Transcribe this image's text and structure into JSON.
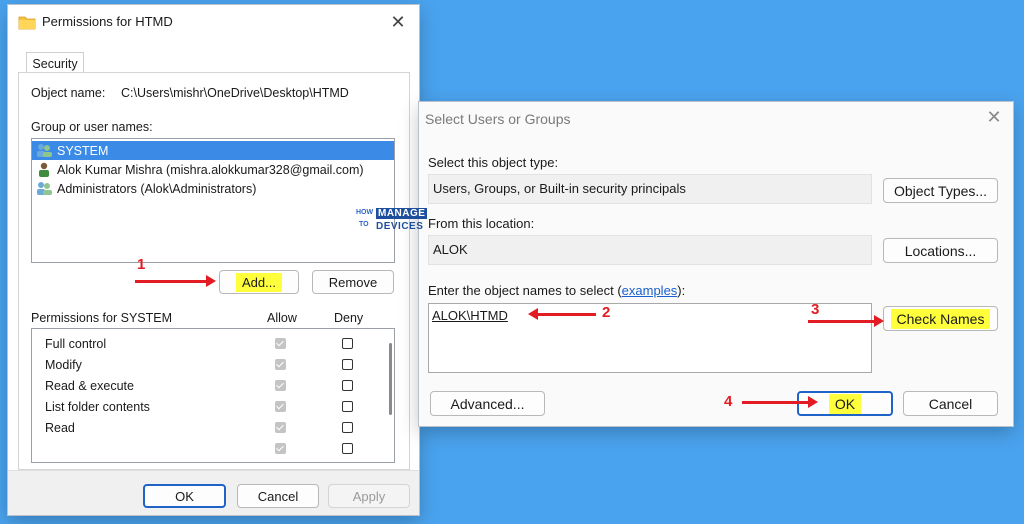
{
  "permissions_dialog": {
    "title": "Permissions for HTMD",
    "tab": "Security",
    "object_name_label": "Object name:",
    "object_name_value": "C:\\Users\\mishr\\OneDrive\\Desktop\\HTMD",
    "group_label": "Group or user names:",
    "users": [
      {
        "name": "SYSTEM",
        "selected": true
      },
      {
        "name": "Alok Kumar Mishra (mishra.alokkumar328@gmail.com)",
        "selected": false
      },
      {
        "name": "Administrators (Alok\\Administrators)",
        "selected": false
      }
    ],
    "add_label": "Add...",
    "remove_label": "Remove",
    "perm_header": "Permissions for SYSTEM",
    "allow_label": "Allow",
    "deny_label": "Deny",
    "permissions": [
      {
        "name": "Full control",
        "allow": true,
        "deny": false
      },
      {
        "name": "Modify",
        "allow": true,
        "deny": false
      },
      {
        "name": "Read & execute",
        "allow": true,
        "deny": false
      },
      {
        "name": "List folder contents",
        "allow": true,
        "deny": false
      },
      {
        "name": "Read",
        "allow": true,
        "deny": false
      }
    ],
    "ok_label": "OK",
    "cancel_label": "Cancel",
    "apply_label": "Apply"
  },
  "select_dialog": {
    "title": "Select Users or Groups",
    "object_type_label": "Select this object type:",
    "object_type_value": "Users, Groups, or Built-in security principals",
    "object_types_btn": "Object Types...",
    "location_label": "From this location:",
    "location_value": "ALOK",
    "locations_btn": "Locations...",
    "enter_label_prefix": "Enter the object names to select (",
    "enter_label_link": "examples",
    "enter_label_suffix": "):",
    "object_names_value": "ALOK\\HTMD",
    "check_names_btn": "Check Names",
    "advanced_btn": "Advanced...",
    "ok_label": "OK",
    "cancel_label": "Cancel"
  },
  "annotations": {
    "step1": "1",
    "step2": "2",
    "step3": "3",
    "step4": "4"
  },
  "watermark": {
    "how": "HOW",
    "to": "TO",
    "manage": "MANAGE",
    "devices": "DEVICES"
  },
  "colors": {
    "background": "#4aa3ee",
    "arrow": "#e31c23",
    "highlight": "#ffff3c",
    "selection": "#3b8ae6"
  }
}
